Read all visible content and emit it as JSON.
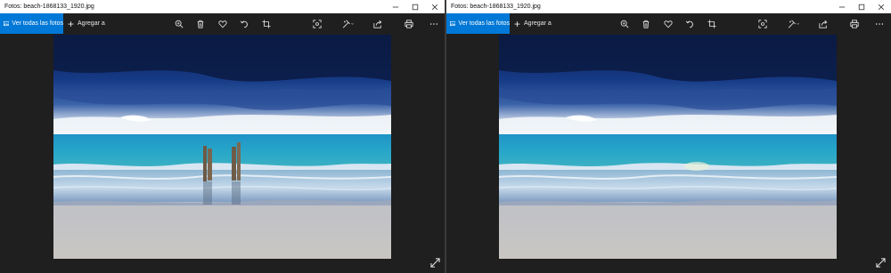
{
  "windows": [
    {
      "title": "Fotos: beach-1868133_1920.jpg",
      "toolbar": {
        "view_all_label": "Ver todas las fotos",
        "add_to_label": "Agregar a",
        "icons": [
          "zoom-icon",
          "delete-icon",
          "heart-icon",
          "rotate-icon",
          "crop-icon",
          "set-on-lockscreen-icon",
          "edit-create-icon",
          "share-icon",
          "print-icon",
          "more-icon"
        ]
      },
      "photo": {
        "subject": "beach",
        "has_posts": true
      }
    },
    {
      "title": "Fotos: beach-1868133_1920.jpg",
      "toolbar": {
        "view_all_label": "Ver todas las fotos",
        "add_to_label": "Agregar a",
        "icons": [
          "zoom-icon",
          "delete-icon",
          "heart-icon",
          "rotate-icon",
          "crop-icon",
          "set-on-lockscreen-icon",
          "edit-create-icon",
          "share-icon",
          "print-icon",
          "more-icon"
        ]
      },
      "photo": {
        "subject": "beach",
        "has_posts": false
      }
    }
  ],
  "colors": {
    "accent": "#0078d7",
    "app_background": "#1f1f1f",
    "titlebar": "#ffffff",
    "toolbar_icon": "#e8e8e8"
  }
}
